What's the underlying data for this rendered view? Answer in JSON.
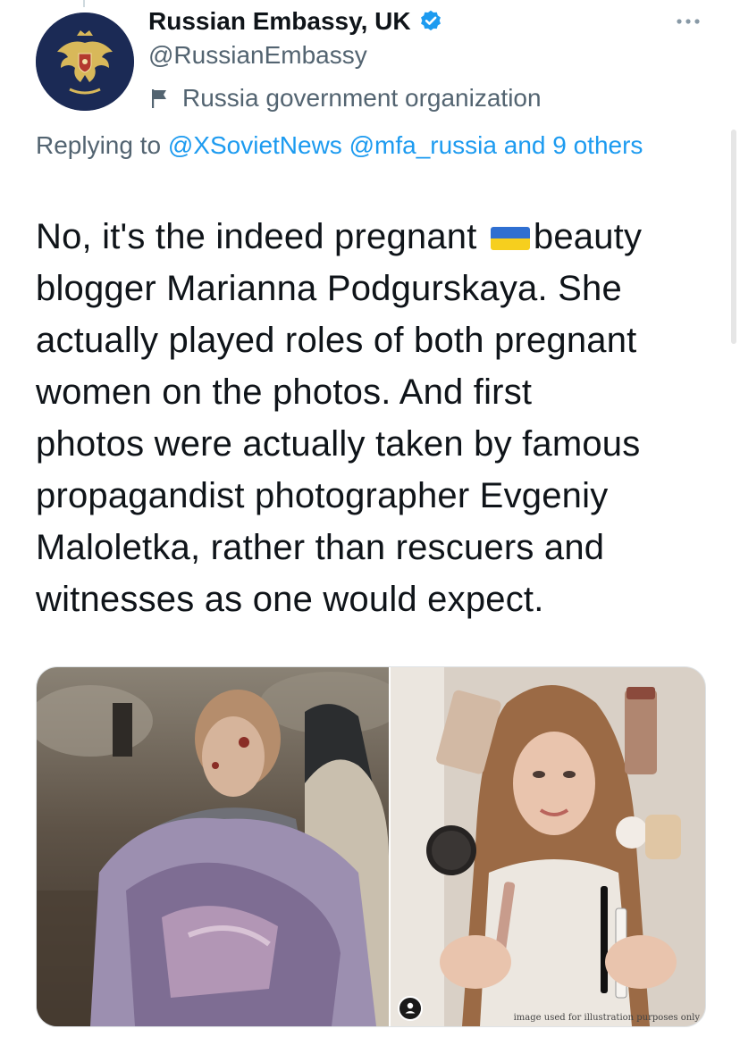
{
  "account": {
    "name": "Russian Embassy, UK",
    "handle": "@RussianEmbassy",
    "label": "Russia government organization",
    "verified": true,
    "avatar_icon": "coat-of-arms-icon"
  },
  "reply": {
    "prefix": "Replying to ",
    "mention1": "@XSovietNews",
    "mention2": "@mfa_russia",
    "suffix": "and 9 others"
  },
  "tweet": {
    "line1_before": "No, it's the indeed pregnant ",
    "line1_after": "beauty",
    "emoji": "ukraine-flag",
    "line2": "blogger Marianna Podgurskaya. She",
    "line3": "actually played roles of both pregnant",
    "line4": "women on the photos. And first",
    "line5": "photos were actually taken by famous",
    "line6": "propagandist photographer Evgeniy",
    "line7": "Maloletka, rather than rescuers and",
    "line8": "witnesses as one would expect."
  },
  "media": {
    "caption": "image used for illustration purposes only",
    "left_photo": "woman-in-rubble-photo",
    "right_photo": "woman-with-cosmetics-photo"
  },
  "colors": {
    "link": "#1d9bf0",
    "secondary_text": "#536471",
    "primary_text": "#0f1419",
    "verified": "#1d9bf0"
  }
}
